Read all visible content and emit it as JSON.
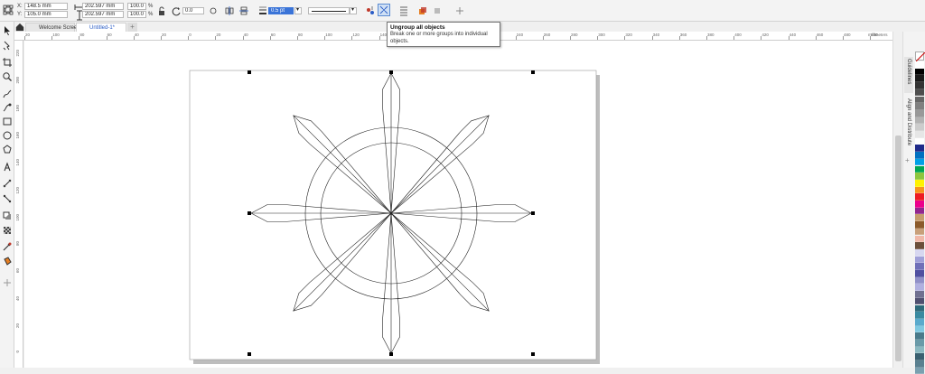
{
  "property_bar": {
    "x_label": "X:",
    "x_value": "148.5 mm",
    "y_label": "Y:",
    "y_value": "105.0 mm",
    "width_value": "202.597 mm",
    "height_value": "202.597 mm",
    "scale_x": "100.0",
    "scale_y": "100.0",
    "percent": "%",
    "rotation": "0.0",
    "outline_width": "0.5 pt",
    "icons": [
      "object-origin-icon",
      "width-icon",
      "height-icon",
      "lock-ratio-icon",
      "rotation-icon",
      "mirror-horizontal-icon",
      "mirror-vertical-icon",
      "outline-width-icon",
      "line-style-dropdown-icon",
      "group-icon",
      "ungroup-all-icon",
      "align-icon",
      "arrange-icon",
      "fill-icon",
      "add-icon"
    ]
  },
  "tabs": {
    "welcome": "Welcome Screen",
    "document": "Untitled-1*",
    "add": "+"
  },
  "ruler": {
    "units": "millimeters",
    "h_labels": [
      "20",
      "100",
      "80",
      "60",
      "40",
      "20",
      "0",
      "20",
      "40",
      "60",
      "80",
      "100",
      "120",
      "140",
      "160",
      "180",
      "200",
      "220",
      "240",
      "260",
      "280",
      "300",
      "320",
      "340",
      "360",
      "380",
      "400",
      "420",
      "440",
      "460",
      "480",
      "500"
    ],
    "v_labels": [
      "220",
      "200",
      "180",
      "160",
      "140",
      "120",
      "100",
      "80",
      "60",
      "40",
      "20",
      "0",
      "20"
    ]
  },
  "toolbox": {
    "tools": [
      "pick-tool-icon",
      "shape-tool-icon",
      "crop-tool-icon",
      "zoom-tool-icon",
      "freehand-tool-icon",
      "artistic-media-tool-icon",
      "rectangle-tool-icon",
      "ellipse-tool-icon",
      "polygon-tool-icon",
      "text-tool-icon",
      "parallel-dimension-tool-icon",
      "connector-tool-icon",
      "drop-shadow-tool-icon",
      "transparency-tool-icon",
      "eyedropper-tool-icon",
      "interactive-fill-tool-icon",
      "add-tool-icon"
    ]
  },
  "tooltip": {
    "title": "Ungroup all objects",
    "body": "Break one or more groups into individual objects."
  },
  "dockers": {
    "guidelines": "Guidelines",
    "align": "Align and Distribute",
    "add": "+"
  },
  "palette": {
    "colors": [
      "#ffffff",
      "#000000",
      "#1a1a1a",
      "#333333",
      "#4d4d4d",
      "#666666",
      "#808080",
      "#999999",
      "#b3b3b3",
      "#cccccc",
      "#e6e6e6",
      "#ffffff",
      "#1f2a8a",
      "#0070c0",
      "#00a0e6",
      "#00a651",
      "#8dc63f",
      "#fff200",
      "#f7941d",
      "#ed1c24",
      "#ec008c",
      "#92278f",
      "#c69c6d",
      "#8b5a2b",
      "#c8a07a",
      "#f0b8a8",
      "#6b4f3a",
      "#d7d7f0",
      "#a0a0d8",
      "#7070b8",
      "#5050a0",
      "#9090c8",
      "#b0b0e0",
      "#707090",
      "#505070",
      "#2e6a7a",
      "#3a8aa0",
      "#5aaacc",
      "#7fc8e0",
      "#4a7a8a",
      "#6a9aa8",
      "#8ab8c0",
      "#3a6070",
      "#5a8090",
      "#7aa0b0"
    ]
  }
}
